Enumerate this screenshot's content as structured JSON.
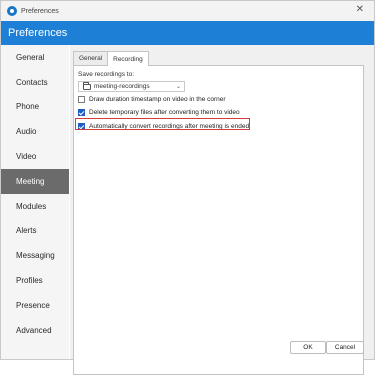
{
  "window": {
    "title": "Preferences"
  },
  "header": {
    "title": "Preferences"
  },
  "sidebar": {
    "items": [
      {
        "label": "General"
      },
      {
        "label": "Contacts"
      },
      {
        "label": "Phone"
      },
      {
        "label": "Audio"
      },
      {
        "label": "Video"
      },
      {
        "label": "Meeting"
      },
      {
        "label": "Modules"
      },
      {
        "label": "Alerts"
      },
      {
        "label": "Messaging"
      },
      {
        "label": "Profiles"
      },
      {
        "label": "Presence"
      },
      {
        "label": "Advanced"
      }
    ],
    "active": "Meeting"
  },
  "tabs": [
    {
      "label": "General"
    },
    {
      "label": "Recording"
    }
  ],
  "active_tab": "Recording",
  "recording": {
    "save_label": "Save recordings to:",
    "folder": "meeting-recordings",
    "options": [
      {
        "label": "Draw duration timestamp on video in the corner",
        "checked": false
      },
      {
        "label": "Delete temporary files after converting them to video",
        "checked": true
      },
      {
        "label": "Automatically convert recordings after meeting is ended",
        "checked": true
      }
    ]
  },
  "buttons": {
    "ok": "OK",
    "cancel": "Cancel"
  },
  "colors": {
    "header": "#1e7fd6",
    "active_sidebar": "#6b6b6b",
    "checkbox": "#1f5fc1",
    "highlight": "#d43c3c"
  }
}
